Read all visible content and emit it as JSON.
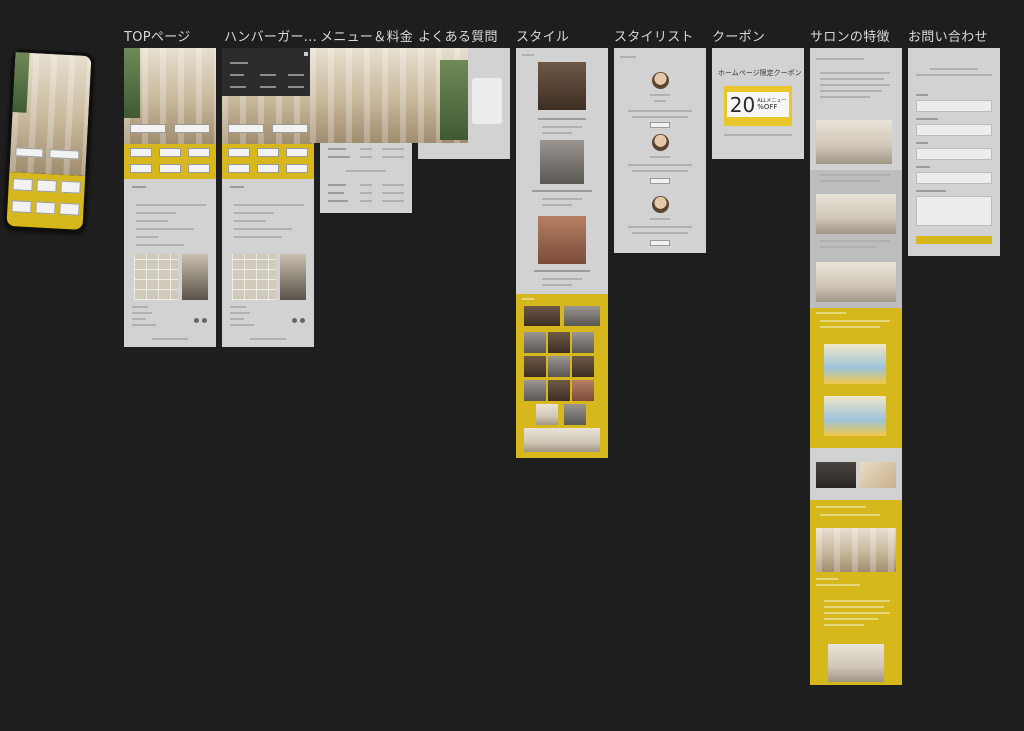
{
  "frames": {
    "top": "TOPページ",
    "hamburger": "ハンバーガー...",
    "menu": "メニュー＆料金",
    "faq": "よくある質問",
    "style": "スタイル",
    "stylist": "スタイリスト",
    "coupon": "クーポン",
    "features": "サロンの特徴",
    "contact": "お問い合わせ"
  },
  "coupon": {
    "title": "ホームページ限定クーポン",
    "percent": "20",
    "all": "ALLメニュー",
    "off": "%OFF"
  },
  "colors": {
    "canvas": "#1e1e1e",
    "frame": "#d2d2d2",
    "accent": "#d6b81c",
    "label": "#d8d8d8"
  }
}
